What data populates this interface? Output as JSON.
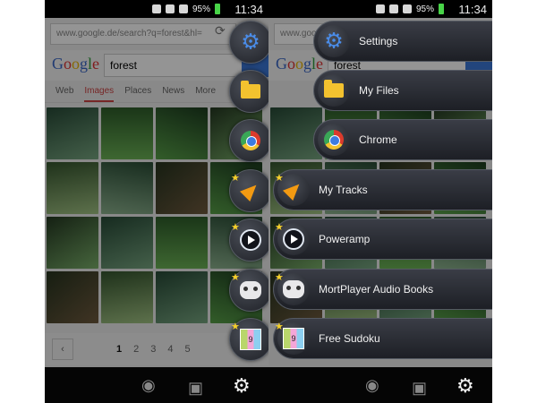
{
  "status_bar": {
    "battery": "95%",
    "time": "11:34"
  },
  "browser": {
    "url": "www.google.de/search?q=forest&hl=",
    "logo": [
      "G",
      "o",
      "o",
      "g",
      "l",
      "e"
    ],
    "query": "forest",
    "tabs": [
      {
        "label": "Web",
        "active": false
      },
      {
        "label": "Images",
        "active": true
      },
      {
        "label": "Places",
        "active": false
      },
      {
        "label": "News",
        "active": false
      },
      {
        "label": "More",
        "active": false
      }
    ],
    "pagination": {
      "prev": "‹",
      "pages": [
        "1",
        "2",
        "3",
        "4",
        "5"
      ],
      "current": "1"
    }
  },
  "menu": {
    "items": [
      {
        "label": "Settings",
        "icon": "settings-gear-icon",
        "starred": false
      },
      {
        "label": "My Files",
        "icon": "folder-icon",
        "starred": false
      },
      {
        "label": "Chrome",
        "icon": "chrome-icon",
        "starred": false
      },
      {
        "label": "My Tracks",
        "icon": "my-tracks-arrow-icon",
        "starred": true
      },
      {
        "label": "Poweramp",
        "icon": "poweramp-play-icon",
        "starred": true
      },
      {
        "label": "MortPlayer Audio Books",
        "icon": "mortplayer-icon",
        "starred": true
      },
      {
        "label": "Free Sudoku",
        "icon": "sudoku-icon",
        "starred": true
      }
    ]
  },
  "nav_bar": {
    "icons": [
      "eye-icon",
      "box-icon",
      "gear-icon"
    ]
  }
}
